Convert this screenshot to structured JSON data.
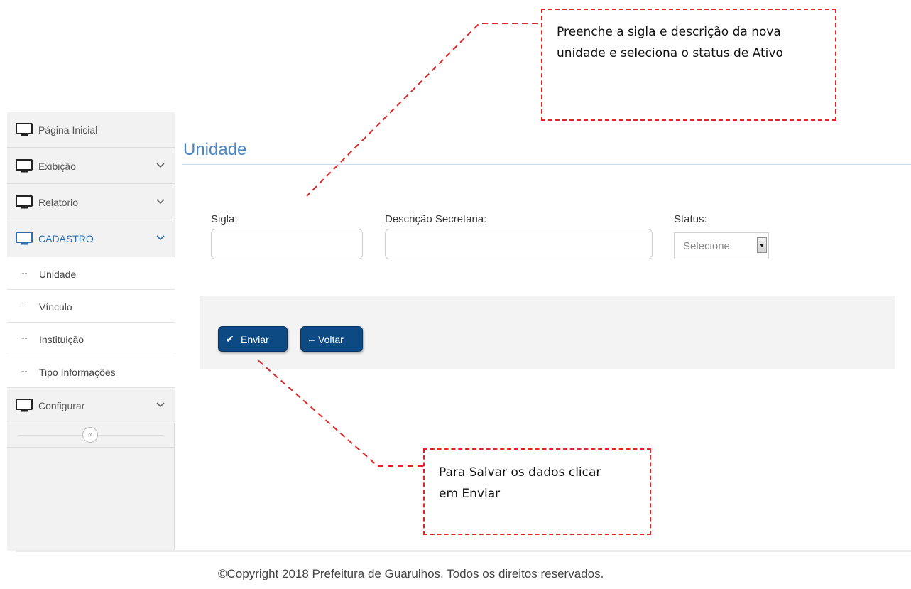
{
  "sidebar": {
    "items": [
      {
        "label": "Página Inicial",
        "icon": "monitor-icon",
        "expandable": false
      },
      {
        "label": "Exibição",
        "icon": "monitor-icon",
        "expandable": true
      },
      {
        "label": "Relatorio",
        "icon": "monitor-icon",
        "expandable": true
      },
      {
        "label": "CADASTRO",
        "icon": "monitor-icon",
        "expandable": true,
        "active": true
      },
      {
        "label": "Configurar",
        "icon": "monitor-icon",
        "expandable": true
      }
    ],
    "subitems": [
      {
        "label": "Unidade"
      },
      {
        "label": "Vínculo"
      },
      {
        "label": "Instituição"
      },
      {
        "label": "Tipo Informações"
      }
    ],
    "collapse_glyph": "«"
  },
  "main": {
    "title": "Unidade",
    "fields": {
      "sigla_label": "Sigla:",
      "sigla_value": "",
      "descricao_label": "Descrição Secretaria:",
      "descricao_value": "",
      "status_label": "Status:",
      "status_selected": "Selecione"
    },
    "buttons": {
      "enviar_label": "Enviar",
      "voltar_label": "Voltar"
    }
  },
  "footer": {
    "copyright": "©Copyright 2018 Prefeitura de Guarulhos. Todos os direitos reservados."
  },
  "callouts": {
    "top_text": "Preenche a sigla e descrição da nova unidade  e seleciona o status de Ativo",
    "bottom_text": "Para Salvar os dados clicar em Enviar"
  },
  "colors": {
    "accent": "#2b6db3",
    "title": "#4b86c2",
    "button": "#0d4a84",
    "callout_border": "#e02525"
  }
}
